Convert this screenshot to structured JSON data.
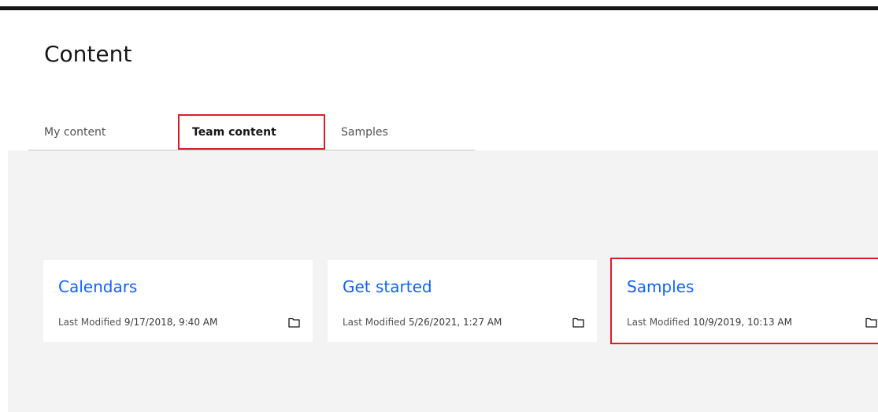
{
  "page": {
    "title": "Content"
  },
  "tabs": [
    {
      "label": "My content",
      "selected": false
    },
    {
      "label": "Team content",
      "selected": true
    },
    {
      "label": "Samples",
      "selected": false
    }
  ],
  "cards": [
    {
      "title": "Calendars",
      "modified_label": "Last Modified",
      "modified_value": "9/17/2018, 9:40 AM",
      "icon": "folder-icon"
    },
    {
      "title": "Get started",
      "modified_label": "Last Modified",
      "modified_value": "5/26/2021, 1:27 AM",
      "icon": "folder-icon"
    },
    {
      "title": "Samples",
      "modified_label": "Last Modified",
      "modified_value": "10/9/2019, 10:13 AM",
      "icon": "folder-icon"
    }
  ],
  "colors": {
    "accent_link": "#0f62fe",
    "highlight_border": "#da1e28",
    "background_panel": "#f3f3f3"
  }
}
